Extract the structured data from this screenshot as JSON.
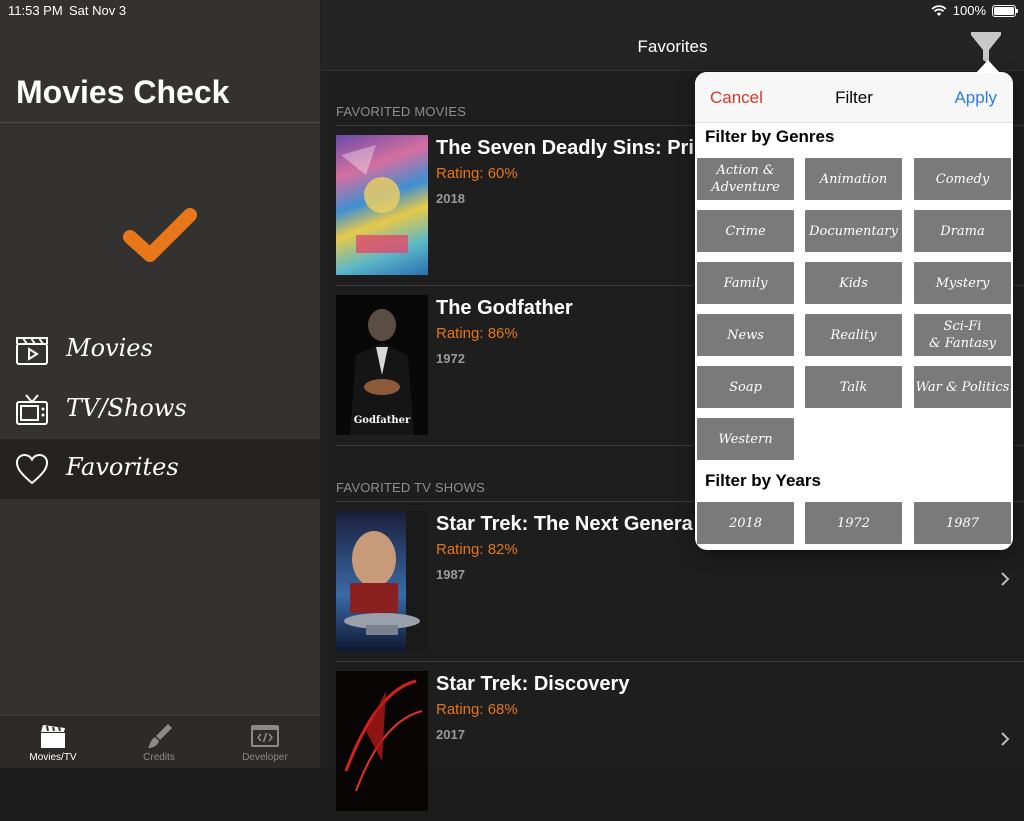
{
  "status": {
    "time": "11:53 PM",
    "date": "Sat Nov 3",
    "battery": "100%"
  },
  "sidebar": {
    "title": "Movies Check",
    "logo": "orange-checkmark",
    "nav": [
      {
        "label": "Movies",
        "icon": "clapperboard-icon"
      },
      {
        "label": "TV/Shows",
        "icon": "television-icon"
      },
      {
        "label": "Favorites",
        "icon": "heart-icon",
        "active": true
      }
    ],
    "tabs": [
      {
        "label": "Movies/TV",
        "icon": "clapperboard-icon"
      },
      {
        "label": "Credits",
        "icon": "brush-icon"
      },
      {
        "label": "Developer",
        "icon": "code-window-icon"
      }
    ]
  },
  "main": {
    "title": "Favorites",
    "sections": [
      {
        "header": "FAVORITED MOVIES",
        "items": [
          {
            "title": "The Seven Deadly Sins: Pri",
            "rating": "Rating: 60%",
            "year": "2018"
          },
          {
            "title": "The Godfather",
            "rating": "Rating: 86%",
            "year": "1972"
          }
        ]
      },
      {
        "header": "FAVORITED TV SHOWS",
        "items": [
          {
            "title": "Star Trek: The Next Genera",
            "rating": "Rating: 82%",
            "year": "1987"
          },
          {
            "title": "Star Trek: Discovery",
            "rating": "Rating: 68%",
            "year": "2017"
          }
        ]
      }
    ]
  },
  "filter": {
    "cancel": "Cancel",
    "title": "Filter",
    "apply": "Apply",
    "genres_header": "Filter by Genres",
    "genres": [
      "Action &\nAdventure",
      "Animation",
      "Comedy",
      "Crime",
      "Documentary",
      "Drama",
      "Family",
      "Kids",
      "Mystery",
      "News",
      "Reality",
      "Sci-Fi\n& Fantasy",
      "Soap",
      "Talk",
      "War & Politics",
      "Western"
    ],
    "years_header": "Filter by Years",
    "years": [
      "2018",
      "1972",
      "1987"
    ]
  },
  "colors": {
    "accent_orange": "#e2761e",
    "cancel_red": "#d3382b",
    "apply_blue": "#2f7ce5",
    "chip_gray": "#7a7a7a"
  }
}
